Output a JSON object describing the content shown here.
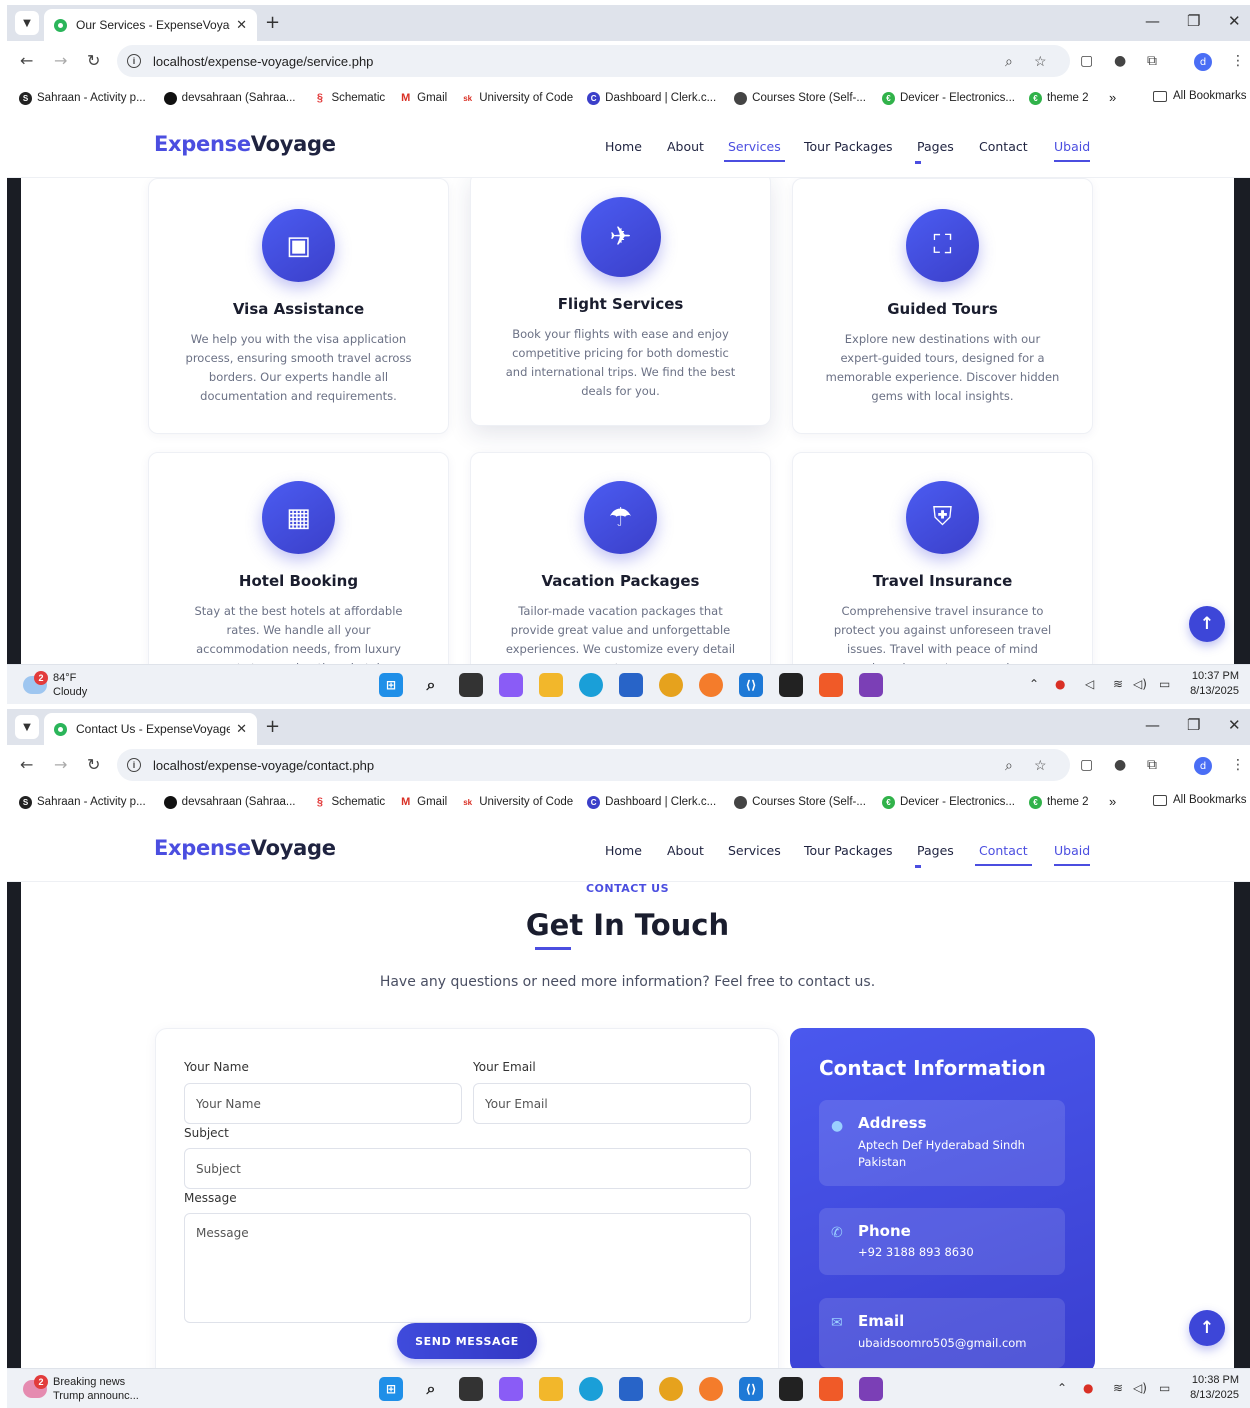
{
  "screenshot1": {
    "tab_title": "Our Services - ExpenseVoyage",
    "url": "localhost/expense-voyage/service.php",
    "services": [
      {
        "title": "Visa Assistance",
        "desc": "We help you with the visa application process, ensuring smooth travel across borders. Our experts handle all documentation and requirements.",
        "icon": "passport-icon"
      },
      {
        "title": "Flight Services",
        "desc": "Book your flights with ease and enjoy competitive pricing for both domestic and international trips. We find the best deals for you.",
        "icon": "plane-icon"
      },
      {
        "title": "Guided Tours",
        "desc": "Explore new destinations with our expert-guided tours, designed for a memorable experience. Discover hidden gems with local insights.",
        "icon": "map-icon"
      },
      {
        "title": "Hotel Booking",
        "desc": "Stay at the best hotels at affordable rates. We handle all your accommodation needs, from luxury resorts to cozy boutique hotels.",
        "icon": "hotel-icon"
      },
      {
        "title": "Vacation Packages",
        "desc": "Tailor-made vacation packages that provide great value and unforgettable experiences. We customize every detail to",
        "icon": "umbrella-beach-icon"
      },
      {
        "title": "Travel Insurance",
        "desc": "Comprehensive travel insurance to protect you against unforeseen travel issues. Travel with peace of mind knowing you're covered.",
        "icon": "shield-icon"
      }
    ],
    "taskbar": {
      "weather_temp": "84°F",
      "weather_desc": "Cloudy",
      "weather_badge": "2",
      "time": "10:37 PM",
      "date": "8/13/2025"
    }
  },
  "screenshot2": {
    "tab_title": "Contact Us - ExpenseVoyage",
    "url": "localhost/expense-voyage/contact.php",
    "eyebrow": "CONTACT US",
    "heading": "Get In Touch",
    "lead": "Have any questions or need more information? Feel free to contact us.",
    "form": {
      "name_label": "Your Name",
      "name_placeholder": "Your Name",
      "email_label": "Your Email",
      "email_placeholder": "Your Email",
      "subject_label": "Subject",
      "subject_placeholder": "Subject",
      "message_label": "Message",
      "message_placeholder": "Message",
      "send_label": "SEND MESSAGE"
    },
    "contact_info": {
      "title": "Contact Information",
      "address_title": "Address",
      "address_value": "Aptech Def Hyderabad Sindh Pakistan",
      "phone_title": "Phone",
      "phone_value": "+92 3188 893 8630",
      "email_title": "Email",
      "email_value": "ubaidsoomro505@gmail.com"
    },
    "taskbar": {
      "news_title": "Breaking news",
      "news_desc": "Trump announc...",
      "news_badge": "2",
      "time": "10:38 PM",
      "date": "8/13/2025"
    }
  },
  "browser": {
    "bookmarks": [
      "Sahraan - Activity p...",
      "devsahraan (Sahraa...",
      "Schematic",
      "Gmail",
      "University of Code",
      "Dashboard | Clerk.c...",
      "Courses Store (Self-...",
      "Devicer - Electronics...",
      "theme 2"
    ],
    "bookmarks_more": "»",
    "all_bookmarks": "All Bookmarks",
    "profile_initial": "d"
  },
  "site": {
    "logo_part1": "Expense",
    "logo_part2": "Voyage",
    "nav": [
      "Home",
      "About",
      "Services",
      "Tour Packages",
      "Pages",
      "Contact",
      "Ubaid"
    ]
  },
  "colors": {
    "brand": "#4b4ee0",
    "dark": "#1f2340",
    "card_blue": "#4353e6"
  }
}
